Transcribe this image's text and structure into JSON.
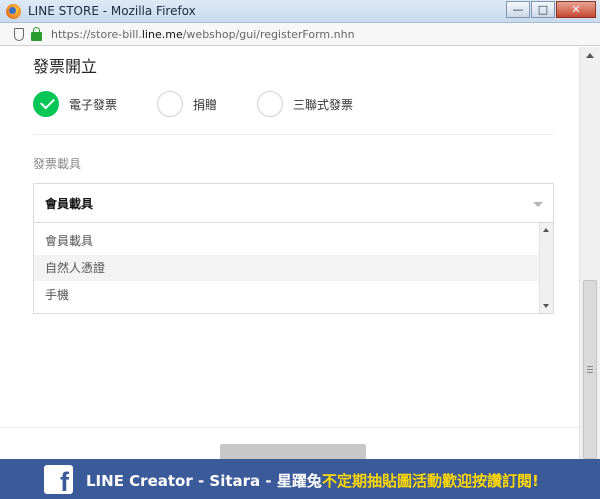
{
  "window": {
    "title": "LINE STORE - Mozilla Firefox",
    "controls": {
      "minimize": "—",
      "maximize": "□",
      "close": "✕"
    }
  },
  "address_bar": {
    "url_prefix": "https://store-bill.",
    "url_host": "line.me",
    "url_path": "/webshop/gui/registerForm.nhn",
    "icons": [
      "shield-icon",
      "lock-icon"
    ]
  },
  "invoice": {
    "title": "發票開立",
    "options": [
      {
        "label": "電子發票",
        "checked": true
      },
      {
        "label": "捐贈",
        "checked": false
      },
      {
        "label": "三聯式發票",
        "checked": false
      }
    ],
    "carrier_label": "發票載具",
    "carrier_selected": "會員載具",
    "carrier_options": [
      "會員載具",
      "自然人憑證",
      "手機"
    ],
    "highlighted_option": "自然人憑證"
  },
  "banner": {
    "icon": "facebook-icon",
    "icon_glyph": "f",
    "left_text": "LINE Creator - Sitara - 星躍兔",
    "right_text": "不定期抽貼圖活動歡迎按讚訂閱!"
  },
  "colors": {
    "accent_green": "#06c755",
    "banner_blue": "#3b5a9a",
    "banner_yellow": "#ffd800"
  }
}
